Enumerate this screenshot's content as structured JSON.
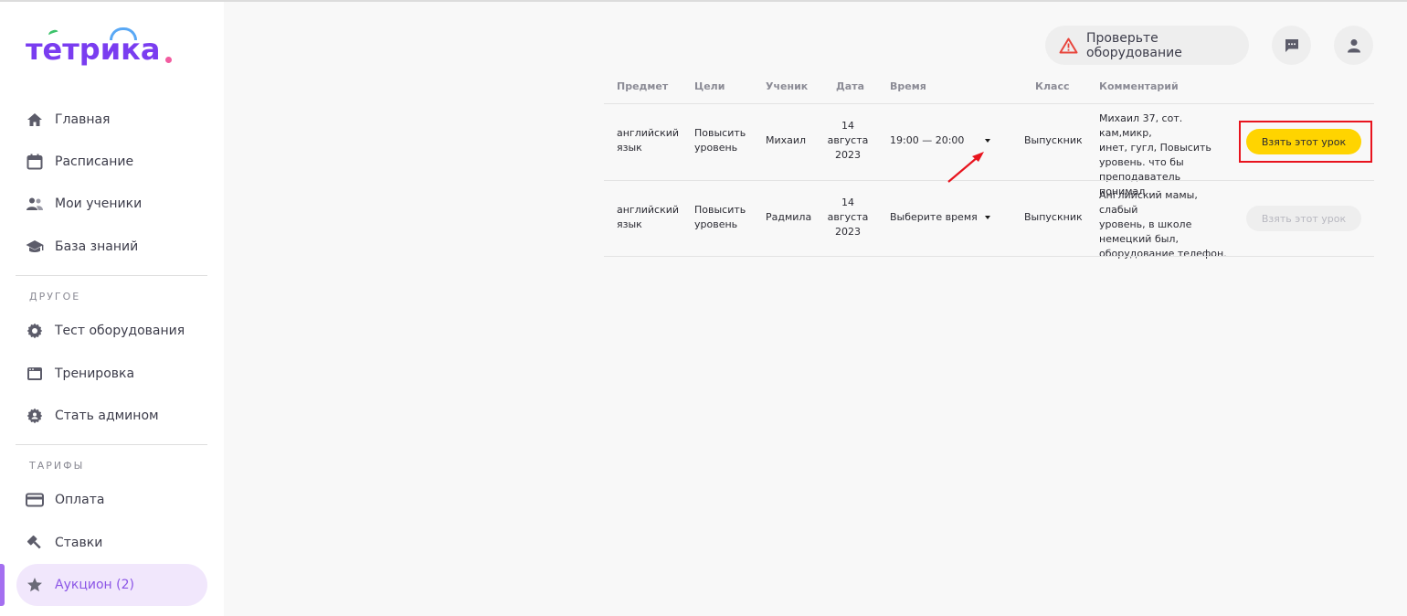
{
  "brand": {
    "logo_text": "тетрика",
    "logo_colors": {
      "text": "#7a3df0",
      "dot": "#f25ca0",
      "accent": "#3cc36a",
      "arc": "#59a8f5"
    }
  },
  "sidebar": {
    "main_items": [
      {
        "label": "Главная",
        "icon": "home-icon"
      },
      {
        "label": "Расписание",
        "icon": "calendar-icon"
      },
      {
        "label": "Мои ученики",
        "icon": "students-icon"
      },
      {
        "label": "База знаний",
        "icon": "graduation-cap-icon"
      }
    ],
    "section_other": "ДРУГОЕ",
    "other_items": [
      {
        "label": "Тест оборудования",
        "icon": "gear-icon"
      },
      {
        "label": "Тренировка",
        "icon": "window-icon"
      },
      {
        "label": "Стать админом",
        "icon": "admin-gear-icon"
      }
    ],
    "section_tariffs": "ТАРИФЫ",
    "tariff_items": [
      {
        "label": "Оплата",
        "icon": "credit-card-icon"
      },
      {
        "label": "Ставки",
        "icon": "gavel-icon"
      },
      {
        "label": "Аукцион (2)",
        "icon": "star-icon",
        "active": true
      }
    ],
    "active_color": "#8b55e6"
  },
  "header": {
    "check_equipment_label": "Проверьте оборудование",
    "warning_color": "#e8453c"
  },
  "table": {
    "columns": [
      "Предмет",
      "Цели",
      "Ученик",
      "Дата",
      "Время",
      "Класс",
      "Комментарий"
    ],
    "rows": [
      {
        "subject": [
          "английский",
          "язык"
        ],
        "goal": [
          "Повысить",
          "уровень"
        ],
        "student": "Михаил",
        "date": [
          "14",
          "августа",
          "2023"
        ],
        "time": "19:00 — 20:00",
        "grade": "Выпускник",
        "comment": [
          "Михаил 37, сот. кам,микр,",
          "инет, гугл, Повысить",
          "уровень. что бы",
          "преподаватель понимал ..."
        ],
        "action": "Взять этот урок",
        "action_enabled": true
      },
      {
        "subject": [
          "английский",
          "язык"
        ],
        "goal": [
          "Повысить",
          "уровень"
        ],
        "student": "Радмила",
        "date": [
          "14",
          "августа",
          "2023"
        ],
        "time": "Выберите время",
        "grade": "Выпускник",
        "comment": [
          "Английский мамы, слабый",
          "уровень, в школе",
          "немецкий был,",
          "оборудование телефон."
        ],
        "action": "Взять этот урок",
        "action_enabled": false
      }
    ],
    "button_color": "#ffd400"
  }
}
